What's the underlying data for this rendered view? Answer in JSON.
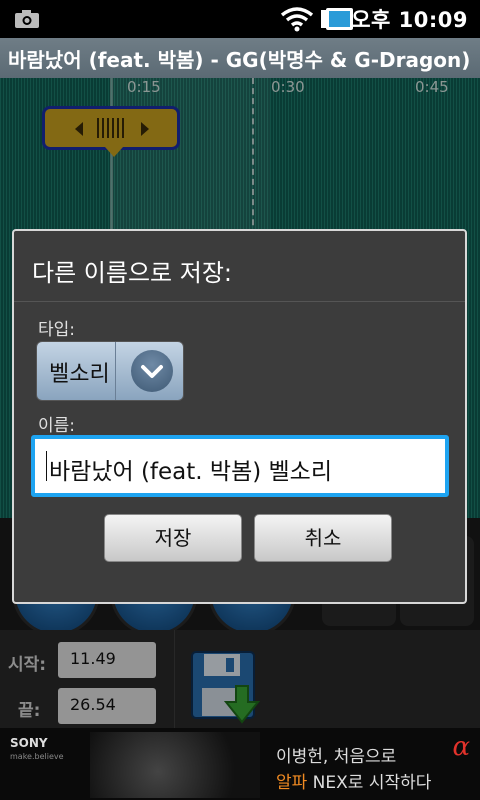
{
  "status_bar": {
    "time": "오후 10:09",
    "icons": [
      "camera-icon",
      "wifi-icon",
      "battery-icon"
    ]
  },
  "title_bar": {
    "title": "바람났어 (feat. 박봄) - GG(박명수 & G-Dragon)"
  },
  "waveform": {
    "ticks": [
      "0:15",
      "0:30",
      "0:45"
    ],
    "color": "#0e5c52",
    "handle_color": "#c9a21f"
  },
  "dialog": {
    "title": "다른 이름으로 저장:",
    "type_label": "타입:",
    "type_value": "벨소리",
    "name_label": "이름:",
    "name_value": "바람났어 (feat. 박봄) 벨소리",
    "save_label": "저장",
    "cancel_label": "취소",
    "accent": "#1ea4f1"
  },
  "fields": {
    "start_label": "시작:",
    "start_value": "11.49",
    "end_label": "끝:",
    "end_value": "26.54"
  },
  "ad": {
    "brand": "SONY",
    "brand_sub": "make.believe",
    "line1": "이병헌, 처음으로",
    "line2_highlight": "알파",
    "line2_rest": " NEX로 시작하다",
    "logo": "α"
  }
}
